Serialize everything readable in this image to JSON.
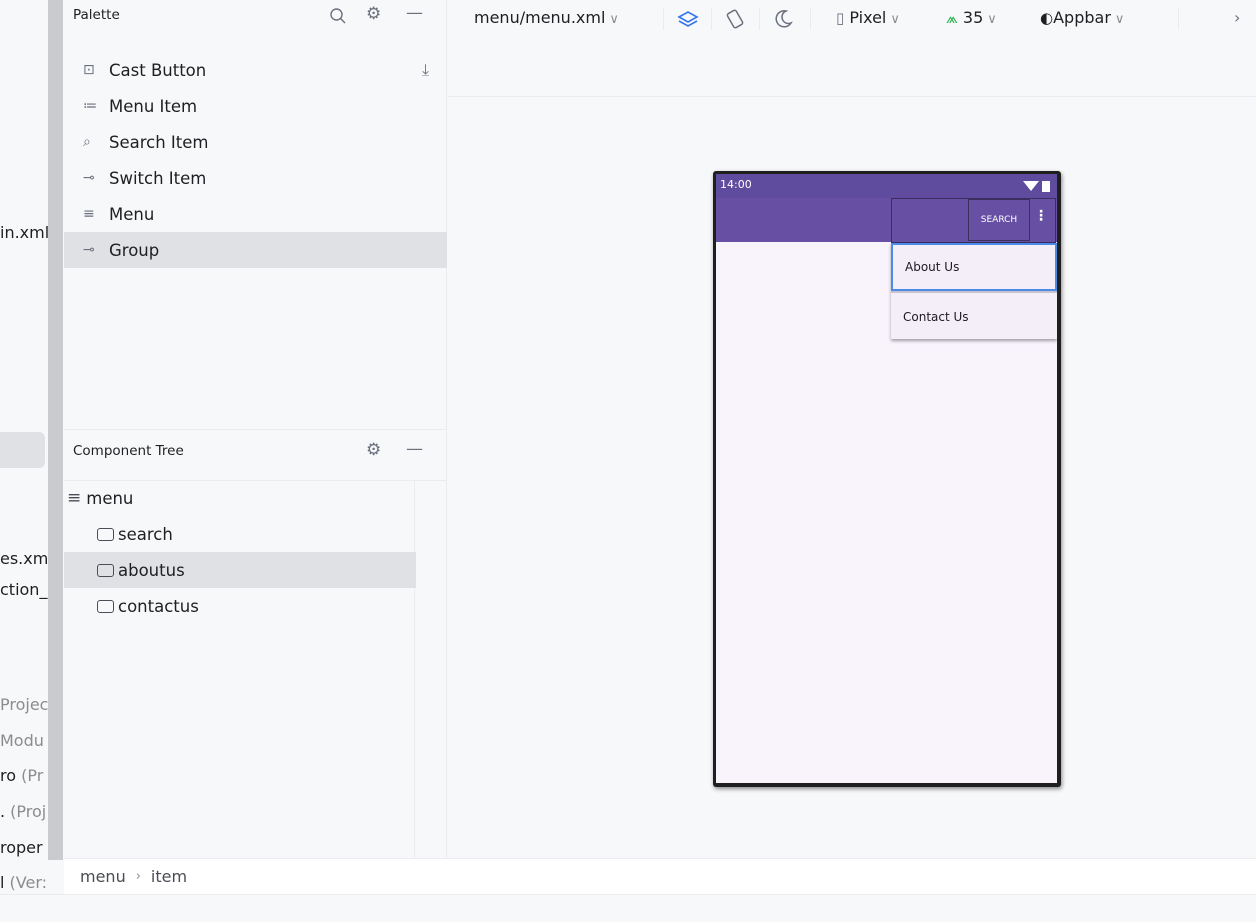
{
  "project": {
    "items": [
      {
        "main": "in.xml",
        "muted": ""
      },
      {
        "main": "es.xm",
        "muted": ""
      },
      {
        "main": "ction_",
        "muted": ""
      },
      {
        "main": "",
        "muted": "Projec"
      },
      {
        "main": "",
        "muted": "Modu"
      },
      {
        "main": "ro ",
        "muted": "(Pr"
      },
      {
        "main": ". ",
        "muted": "(Proj"
      },
      {
        "main": "roper",
        "muted": ""
      },
      {
        "main": "l ",
        "muted": "(Ver:"
      }
    ]
  },
  "palette": {
    "title": "Palette",
    "items": [
      {
        "label": "Cast Button",
        "icon": "cast-icon"
      },
      {
        "label": "Menu Item",
        "icon": "menu-item-icon"
      },
      {
        "label": "Search Item",
        "icon": "search-item-icon"
      },
      {
        "label": "Switch Item",
        "icon": "switch-item-icon"
      },
      {
        "label": "Menu",
        "icon": "menu-icon"
      },
      {
        "label": "Group",
        "icon": "group-icon"
      }
    ],
    "selected": "Group"
  },
  "component_tree": {
    "title": "Component Tree",
    "root": "menu",
    "children": [
      "search",
      "aboutus",
      "contactus"
    ],
    "selected": "aboutus"
  },
  "toolbar": {
    "file": "menu/menu.xml",
    "device": "Pixel",
    "api": "35",
    "theme": "Appbar"
  },
  "phone": {
    "time": "14:00",
    "action_search": "SEARCH",
    "menu_items": [
      "About Us",
      "Contact Us"
    ],
    "highlighted": "About Us",
    "colors": {
      "appbar": "#6750a4",
      "statusbar": "#604c9e",
      "background": "#f9f3fc"
    }
  },
  "breadcrumb": {
    "parts": [
      "menu",
      "item"
    ]
  }
}
